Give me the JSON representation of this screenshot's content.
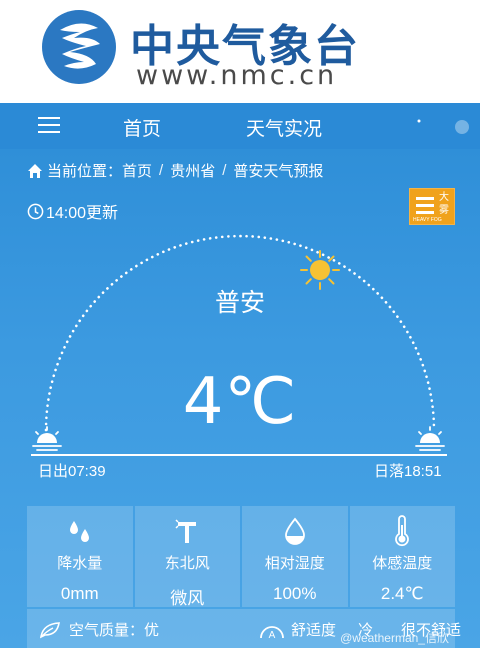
{
  "header": {
    "site_name": "中央气象台",
    "site_url": "www.nmc.cn"
  },
  "nav": {
    "items": [
      {
        "label": "首页"
      },
      {
        "label": "天气实况"
      }
    ]
  },
  "breadcrumb": {
    "prefix": "当前位置：",
    "items": [
      "首页",
      "贵州省",
      "普安天气预报"
    ]
  },
  "update": {
    "text": "14:00更新"
  },
  "alert": {
    "label": "大雾",
    "sub": "HEAVY FOG"
  },
  "current": {
    "city": "普安",
    "temperature": "4℃",
    "sunrise": "日出07:39",
    "sunset": "日落18:51"
  },
  "cards": [
    {
      "label": "降水量",
      "value": "0mm",
      "icon": "raindrops-icon"
    },
    {
      "label": "东北风",
      "value": "微风",
      "icon": "wind-vane-icon"
    },
    {
      "label": "相对湿度",
      "value": "100%",
      "icon": "humidity-drop-icon"
    },
    {
      "label": "体感温度",
      "value": "2.4℃",
      "icon": "thermometer-icon"
    }
  ],
  "bottom": {
    "air_quality": "空气质量：优",
    "comfort_label": "舒适度",
    "comfort_cold": "冷",
    "comfort_value": "很不舒适",
    "watermark": "@weatherman_信欣"
  },
  "colors": {
    "brand_blue": "#1f5b9e",
    "nav_blue": "#2b8ad6",
    "sky": "#3c9ae0",
    "alert_orange": "#f0a21c",
    "sun": "#f6c233"
  }
}
